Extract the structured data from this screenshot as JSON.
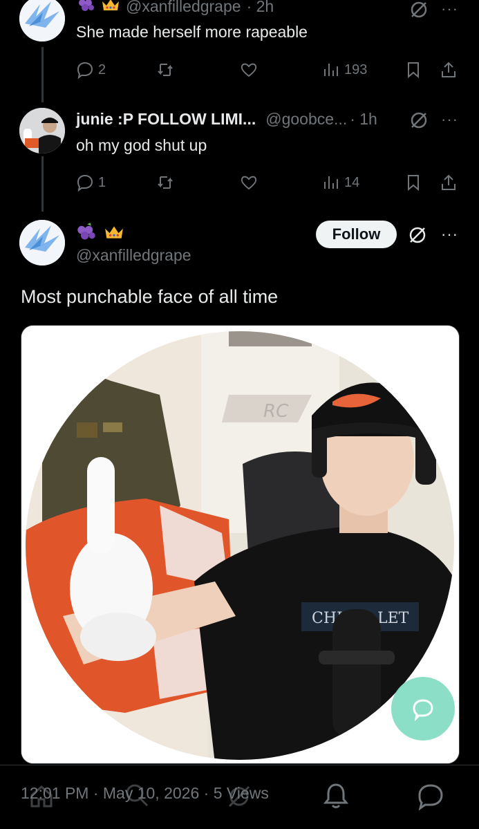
{
  "tweets": [
    {
      "handle": "@xanfilledgrape",
      "time": "· 2h",
      "text": "She made herself more rapeable",
      "replies": "2",
      "views": "193"
    },
    {
      "name": "junie :P FOLLOW LIMI...",
      "handle": "@goobce...",
      "time": "· 1h",
      "text": "oh my god shut up",
      "replies": "1",
      "views": "14"
    }
  ],
  "main": {
    "handle": "@xanfilledgrape",
    "follow_label": "Follow",
    "text": "Most punchable face of all time",
    "shirt_text_left": "CHI",
    "shirt_text_right": "LET"
  },
  "footer": {
    "meta": "12:01 PM · May 10, 2026 · 5 Views"
  },
  "colors": {
    "background": "#000000",
    "text": "#e7e9ea",
    "muted": "#71767b",
    "fab": "#7fdcc0"
  }
}
